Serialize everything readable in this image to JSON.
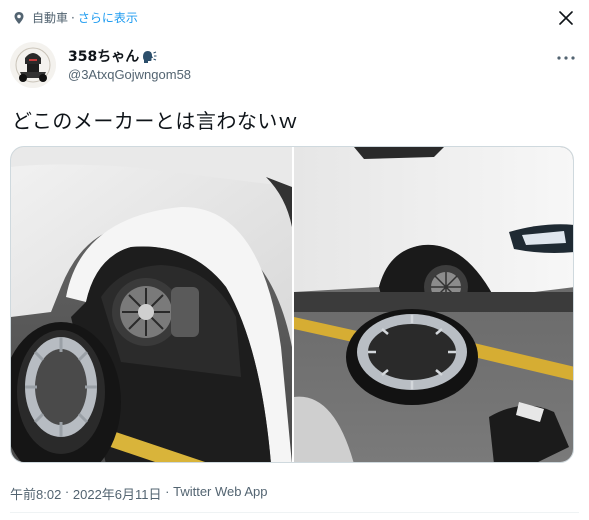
{
  "context": {
    "label": "自動車",
    "separator": "·",
    "more_link": "さらに表示"
  },
  "author": {
    "display_name": "358ちゃん",
    "handle": "@3AtxqGojwngom58"
  },
  "tweet": {
    "text": "どこのメーカーとは言わないｗ"
  },
  "media": {
    "photos": [
      {
        "alt": ""
      },
      {
        "alt": ""
      }
    ]
  },
  "meta": {
    "time": "午前8:02",
    "sep1": " · ",
    "date": "2022年6月11日",
    "sep2": " · ",
    "source": "Twitter Web App"
  },
  "icons": {
    "context": "location-pin-icon",
    "close": "close-icon",
    "more": "more-icon",
    "emoji": "speaking-head-icon"
  }
}
